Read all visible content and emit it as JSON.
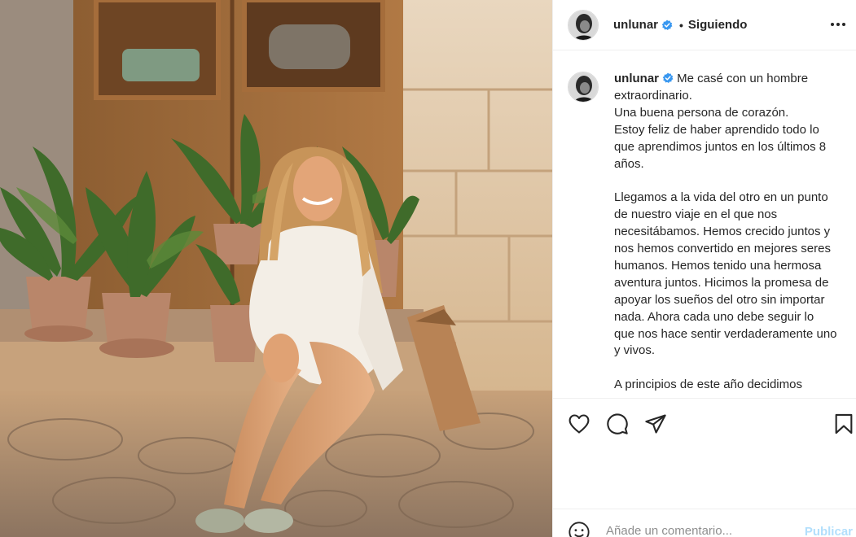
{
  "post": {
    "username": "unlunar",
    "follow_status": "Siguiendo",
    "dot": "•",
    "caption_lines": [
      "Me casé con un hombre",
      "extraordinario.",
      "Una buena persona de corazón.",
      "Estoy feliz de haber aprendido todo lo",
      "que aprendimos juntos en los últimos 8",
      "años."
    ],
    "caption_lines_2": [
      "Llegamos a la vida del otro en un punto",
      "de nuestro viaje en el que nos",
      "necesitábamos. Hemos crecido juntos y",
      "nos hemos convertido en mejores seres",
      "humanos. Hemos tenido una hermosa",
      "aventura juntos. Hicimos la promesa de",
      "apoyar los sueños del otro sin importar",
      "nada. Ahora cada uno debe seguir lo",
      "que nos hace sentir verdaderamente uno",
      "y vivos."
    ],
    "caption_lines_3": [
      "A principios de este año decidimos"
    ]
  },
  "comment": {
    "placeholder": "Añade un comentario...",
    "publish_label": "Publicar"
  },
  "icons": {
    "like": "heart-icon",
    "comment": "comment-icon",
    "share": "send-icon",
    "save": "bookmark-icon",
    "emoji": "emoji-icon",
    "verified": "verified-badge-icon",
    "more": "more-options-icon"
  },
  "colors": {
    "verified": "#3897f0",
    "publish_disabled": "#b2dffc",
    "text": "#262626"
  }
}
